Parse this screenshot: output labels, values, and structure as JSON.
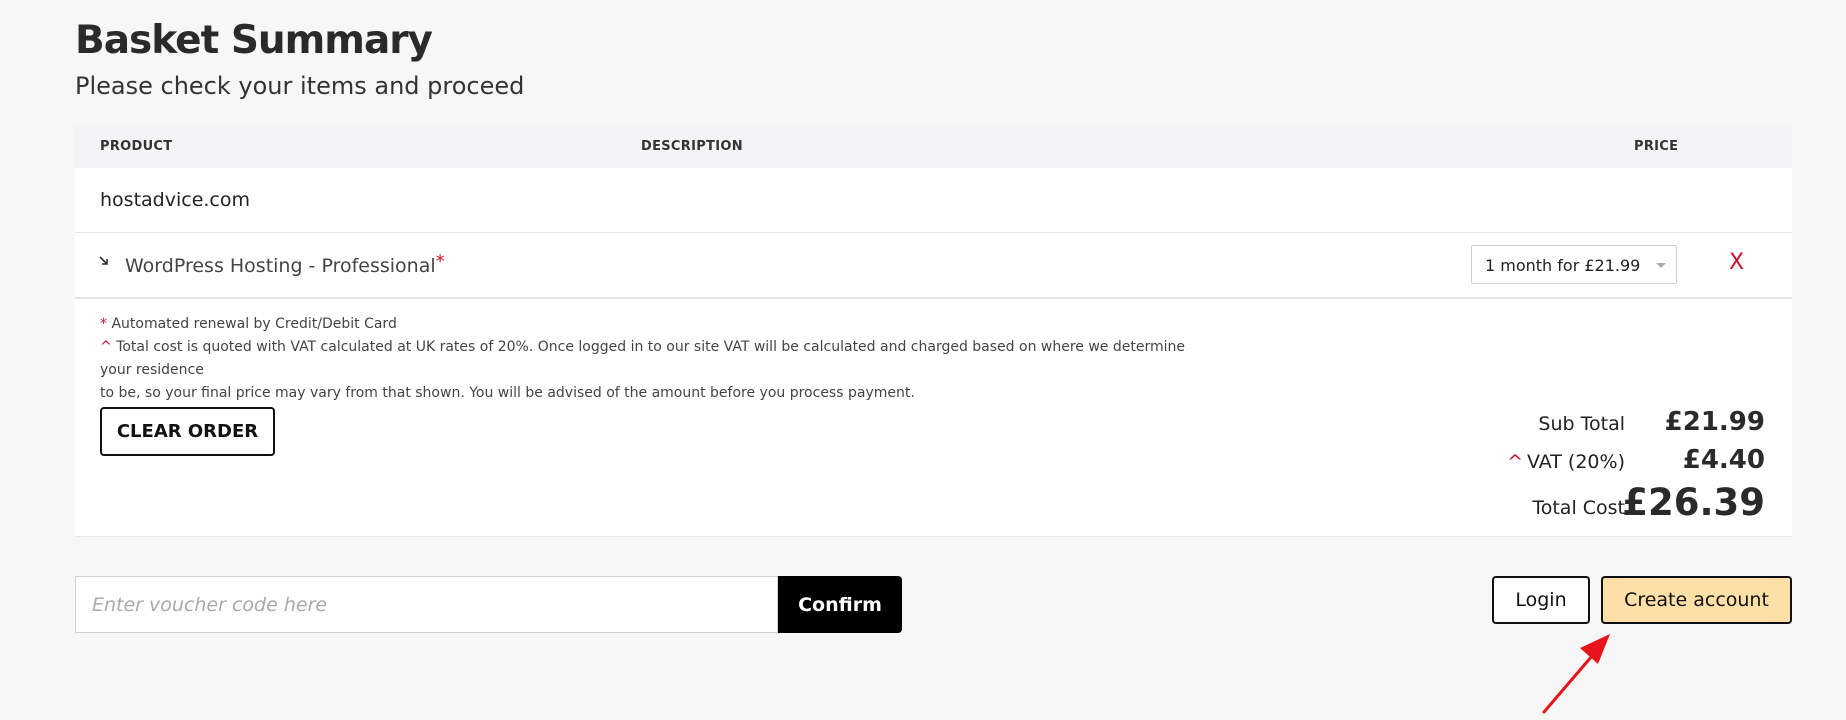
{
  "header": {
    "title": "Basket Summary",
    "subtitle": "Please check your items and proceed"
  },
  "table": {
    "columns": [
      "PRODUCT",
      "DESCRIPTION",
      "PRICE"
    ],
    "domain": "hostadvice.com",
    "item": {
      "name": "WordPress Hosting - Professional",
      "required_mark": "*",
      "term": "1 month for £21.99",
      "remove_label": "X"
    }
  },
  "notes": {
    "renewal_mark": "*",
    "renewal": "Automated renewal by Credit/Debit Card",
    "vat_mark": "^",
    "vat_note_line1": "Total cost is quoted with VAT calculated at UK rates of 20%. Once logged in to our site VAT will be calculated and charged based on where we determine your residence",
    "vat_note_line2": "to be, so your final price may vary from that shown. You will be advised of the amount before you process payment."
  },
  "actions": {
    "clear_order": "CLEAR ORDER",
    "voucher_placeholder": "Enter voucher code here",
    "confirm": "Confirm",
    "login": "Login",
    "create_account": "Create account"
  },
  "totals": {
    "sub_total_label": "Sub Total",
    "sub_total": "£21.99",
    "vat_mark": "^",
    "vat_label": "VAT (20%)",
    "vat": "£4.40",
    "total_label": "Total Cost",
    "total": "£26.39"
  },
  "colors": {
    "accent_red": "#c8102e",
    "create_account_bg": "#fde0a8",
    "arrow": "#e8141c"
  }
}
